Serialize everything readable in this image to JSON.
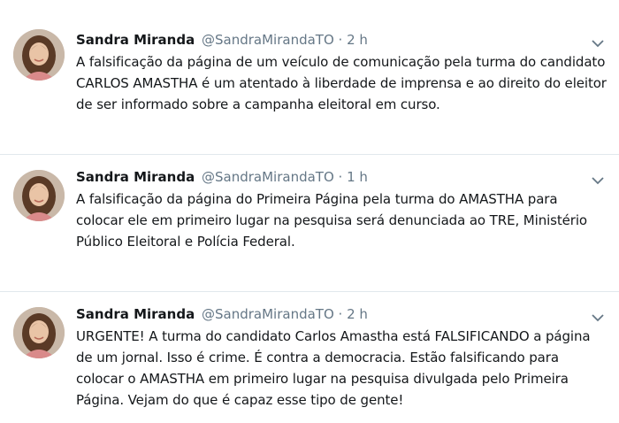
{
  "tweets": [
    {
      "name": "Sandra Miranda",
      "handle": "@SandraMirandaTO",
      "separator": "·",
      "time": "2 h",
      "text": "A falsificação da página de um veículo de comunicação pela turma do candidato CARLOS AMASTHA é um atentado à liberdade de imprensa e ao direito do eleitor de ser informado sobre a campanha eleitoral em curso."
    },
    {
      "name": "Sandra Miranda",
      "handle": "@SandraMirandaTO",
      "separator": "·",
      "time": "1 h",
      "text": "A falsificação da página do Primeira Página pela turma do AMASTHA para colocar ele em primeiro lugar na pesquisa será denunciada ao TRE, Ministério Público Eleitoral e Polícia Federal."
    },
    {
      "name": "Sandra Miranda",
      "handle": "@SandraMirandaTO",
      "separator": "·",
      "time": "2 h",
      "text": "URGENTE! A turma do candidato Carlos Amastha está FALSIFICANDO a página de um jornal. Isso é crime. É contra a democracia. Estão falsificando para colocar o AMASTHA em primeiro lugar na pesquisa divulgada pelo Primeira Página. Vejam do que é capaz esse tipo de gente!"
    }
  ],
  "icons": {
    "avatar": "avatar-photo",
    "menu": "chevron-down-icon"
  },
  "colors": {
    "text": "#14171a",
    "secondary": "#657786",
    "divider": "#e1e8ed"
  }
}
